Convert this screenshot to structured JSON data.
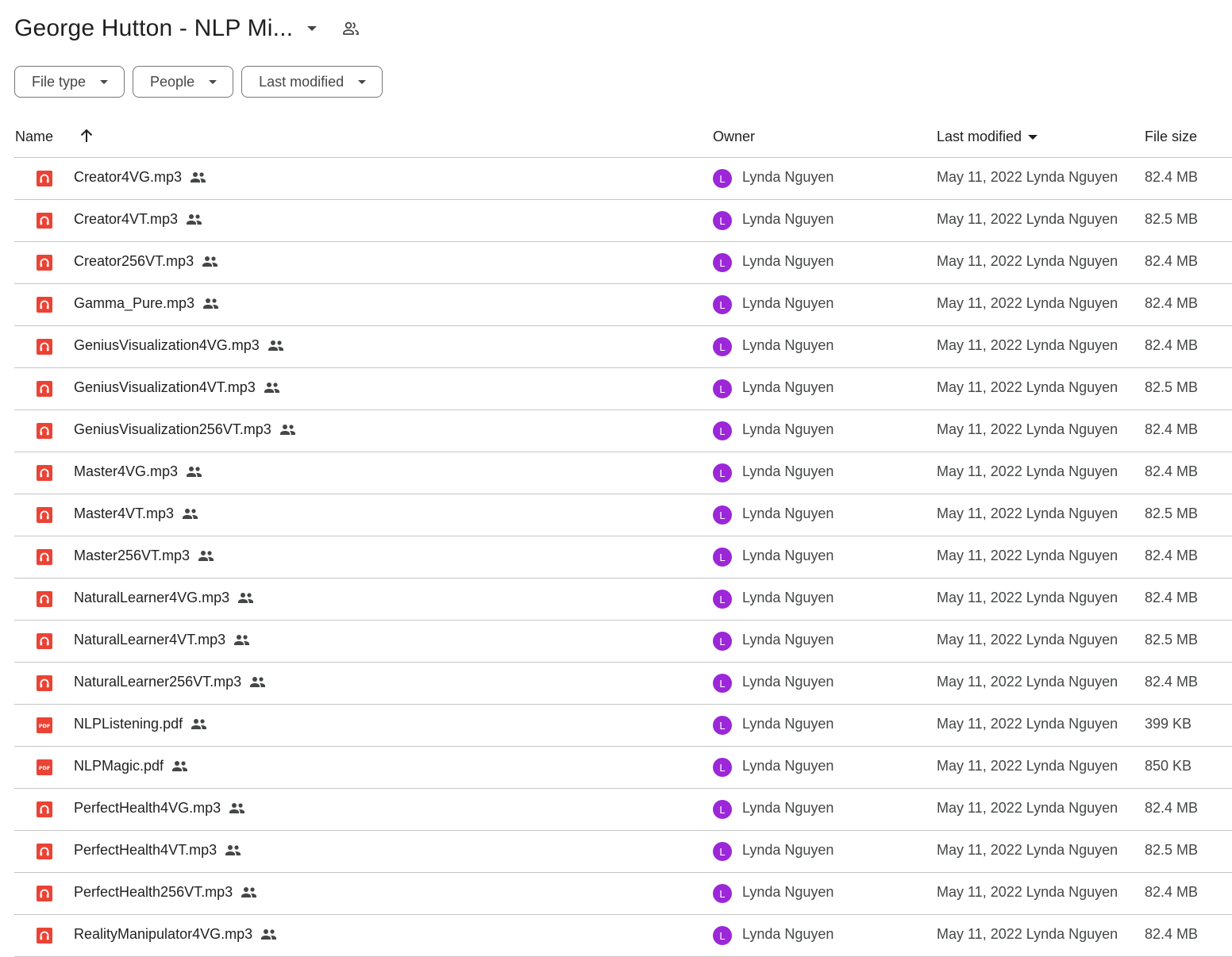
{
  "folder": {
    "title": "George Hutton - NLP Mi...",
    "title_menu_icon": "caret-down-icon",
    "shared_icon": "shared-people-icon"
  },
  "filters": [
    {
      "label": "File type"
    },
    {
      "label": "People"
    },
    {
      "label": "Last modified"
    }
  ],
  "columns": {
    "name": "Name",
    "owner": "Owner",
    "last_modified": "Last modified",
    "file_size": "File size",
    "sort_icon": "arrow-up-icon"
  },
  "colors": {
    "audio_icon": "#ea4335",
    "pdf_icon": "#ea4335",
    "avatar": "#9c27d8"
  },
  "files": [
    {
      "name": "Creator4VG.mp3",
      "type": "audio",
      "owner_initial": "L",
      "owner": "Lynda Nguyen",
      "modified": "May 11, 2022 Lynda Nguyen",
      "size": "82.4 MB"
    },
    {
      "name": "Creator4VT.mp3",
      "type": "audio",
      "owner_initial": "L",
      "owner": "Lynda Nguyen",
      "modified": "May 11, 2022 Lynda Nguyen",
      "size": "82.5 MB"
    },
    {
      "name": "Creator256VT.mp3",
      "type": "audio",
      "owner_initial": "L",
      "owner": "Lynda Nguyen",
      "modified": "May 11, 2022 Lynda Nguyen",
      "size": "82.4 MB"
    },
    {
      "name": "Gamma_Pure.mp3",
      "type": "audio",
      "owner_initial": "L",
      "owner": "Lynda Nguyen",
      "modified": "May 11, 2022 Lynda Nguyen",
      "size": "82.4 MB"
    },
    {
      "name": "GeniusVisualization4VG.mp3",
      "type": "audio",
      "owner_initial": "L",
      "owner": "Lynda Nguyen",
      "modified": "May 11, 2022 Lynda Nguyen",
      "size": "82.4 MB"
    },
    {
      "name": "GeniusVisualization4VT.mp3",
      "type": "audio",
      "owner_initial": "L",
      "owner": "Lynda Nguyen",
      "modified": "May 11, 2022 Lynda Nguyen",
      "size": "82.5 MB"
    },
    {
      "name": "GeniusVisualization256VT.mp3",
      "type": "audio",
      "owner_initial": "L",
      "owner": "Lynda Nguyen",
      "modified": "May 11, 2022 Lynda Nguyen",
      "size": "82.4 MB"
    },
    {
      "name": "Master4VG.mp3",
      "type": "audio",
      "owner_initial": "L",
      "owner": "Lynda Nguyen",
      "modified": "May 11, 2022 Lynda Nguyen",
      "size": "82.4 MB"
    },
    {
      "name": "Master4VT.mp3",
      "type": "audio",
      "owner_initial": "L",
      "owner": "Lynda Nguyen",
      "modified": "May 11, 2022 Lynda Nguyen",
      "size": "82.5 MB"
    },
    {
      "name": "Master256VT.mp3",
      "type": "audio",
      "owner_initial": "L",
      "owner": "Lynda Nguyen",
      "modified": "May 11, 2022 Lynda Nguyen",
      "size": "82.4 MB"
    },
    {
      "name": "NaturalLearner4VG.mp3",
      "type": "audio",
      "owner_initial": "L",
      "owner": "Lynda Nguyen",
      "modified": "May 11, 2022 Lynda Nguyen",
      "size": "82.4 MB"
    },
    {
      "name": "NaturalLearner4VT.mp3",
      "type": "audio",
      "owner_initial": "L",
      "owner": "Lynda Nguyen",
      "modified": "May 11, 2022 Lynda Nguyen",
      "size": "82.5 MB"
    },
    {
      "name": "NaturalLearner256VT.mp3",
      "type": "audio",
      "owner_initial": "L",
      "owner": "Lynda Nguyen",
      "modified": "May 11, 2022 Lynda Nguyen",
      "size": "82.4 MB"
    },
    {
      "name": "NLPListening.pdf",
      "type": "pdf",
      "owner_initial": "L",
      "owner": "Lynda Nguyen",
      "modified": "May 11, 2022 Lynda Nguyen",
      "size": "399 KB"
    },
    {
      "name": "NLPMagic.pdf",
      "type": "pdf",
      "owner_initial": "L",
      "owner": "Lynda Nguyen",
      "modified": "May 11, 2022 Lynda Nguyen",
      "size": "850 KB"
    },
    {
      "name": "PerfectHealth4VG.mp3",
      "type": "audio",
      "owner_initial": "L",
      "owner": "Lynda Nguyen",
      "modified": "May 11, 2022 Lynda Nguyen",
      "size": "82.4 MB"
    },
    {
      "name": "PerfectHealth4VT.mp3",
      "type": "audio",
      "owner_initial": "L",
      "owner": "Lynda Nguyen",
      "modified": "May 11, 2022 Lynda Nguyen",
      "size": "82.5 MB"
    },
    {
      "name": "PerfectHealth256VT.mp3",
      "type": "audio",
      "owner_initial": "L",
      "owner": "Lynda Nguyen",
      "modified": "May 11, 2022 Lynda Nguyen",
      "size": "82.4 MB"
    },
    {
      "name": "RealityManipulator4VG.mp3",
      "type": "audio",
      "owner_initial": "L",
      "owner": "Lynda Nguyen",
      "modified": "May 11, 2022 Lynda Nguyen",
      "size": "82.4 MB"
    }
  ]
}
